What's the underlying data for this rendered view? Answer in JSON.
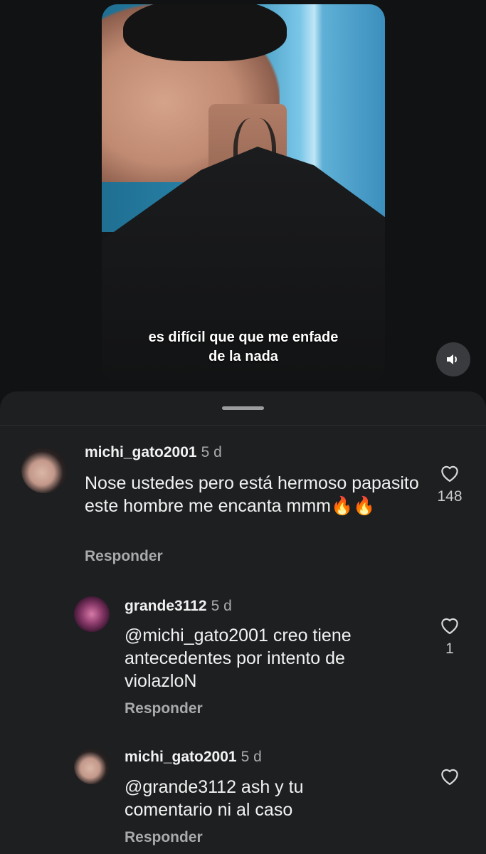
{
  "video": {
    "subtitle_line1": "es difícil que que me enfade",
    "subtitle_line2": "de la nada",
    "mute_icon": "speaker-icon"
  },
  "comments": [
    {
      "username": "michi_gato2001",
      "time": "5 d",
      "text": "Nose ustedes pero está hermoso papasito este hombre me encanta mmm🔥🔥",
      "reply_label": "Responder",
      "likes": "148"
    },
    {
      "username": "grande3112",
      "time": "5 d",
      "mention": "@michi_gato2001",
      "text": " creo tiene antecedentes por intento de violazloN",
      "reply_label": "Responder",
      "likes": "1"
    },
    {
      "username": "michi_gato2001",
      "time": "5 d",
      "mention": "@grande3112",
      "text": " ash y tu comentario ni al caso",
      "reply_label": "Responder",
      "likes": ""
    }
  ],
  "colors": {
    "background": "#0f1113",
    "sheet": "#1d1f21",
    "secondary_text": "#a9aaac"
  }
}
